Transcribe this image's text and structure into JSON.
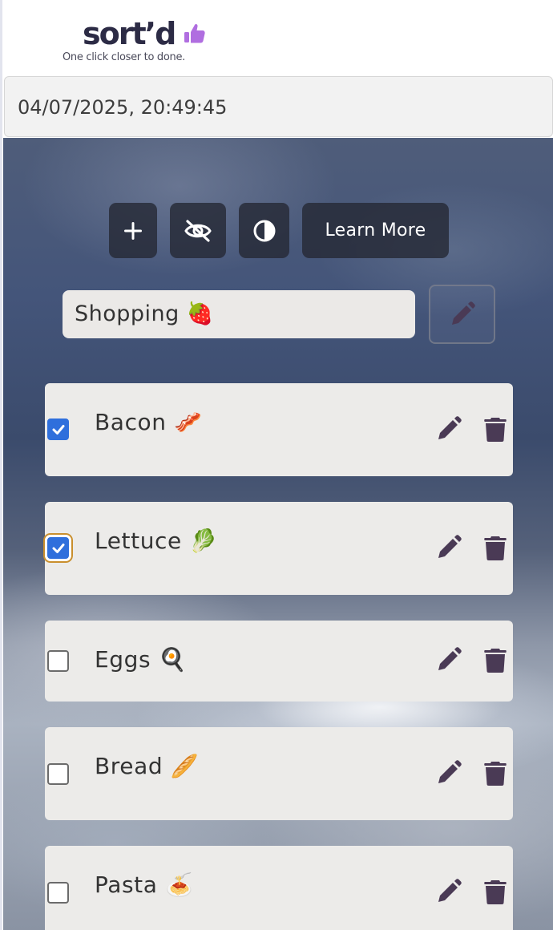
{
  "app": {
    "logo_text": "sort’d",
    "tagline": "One click closer to done.",
    "colors": {
      "logo": "#2c2b45",
      "thumb": "#b06ee0",
      "icon": "#4a3a55",
      "checkbox": "#2f6fdc"
    }
  },
  "timestamp": "04/07/2025, 20:49:45",
  "toolbar": {
    "add_icon": "plus-icon",
    "hide_icon": "eye-slash-icon",
    "contrast_icon": "contrast-icon",
    "learn_more_label": "Learn More"
  },
  "list": {
    "name": "Shopping 🍓",
    "edit_icon": "pencil-icon"
  },
  "items": [
    {
      "label": "Bacon 🥓",
      "checked": true
    },
    {
      "label": "Lettuce 🥬",
      "checked": true
    },
    {
      "label": "Eggs 🍳",
      "checked": false
    },
    {
      "label": "Bread 🥖",
      "checked": false
    },
    {
      "label": "Pasta 🍝",
      "checked": false
    }
  ]
}
